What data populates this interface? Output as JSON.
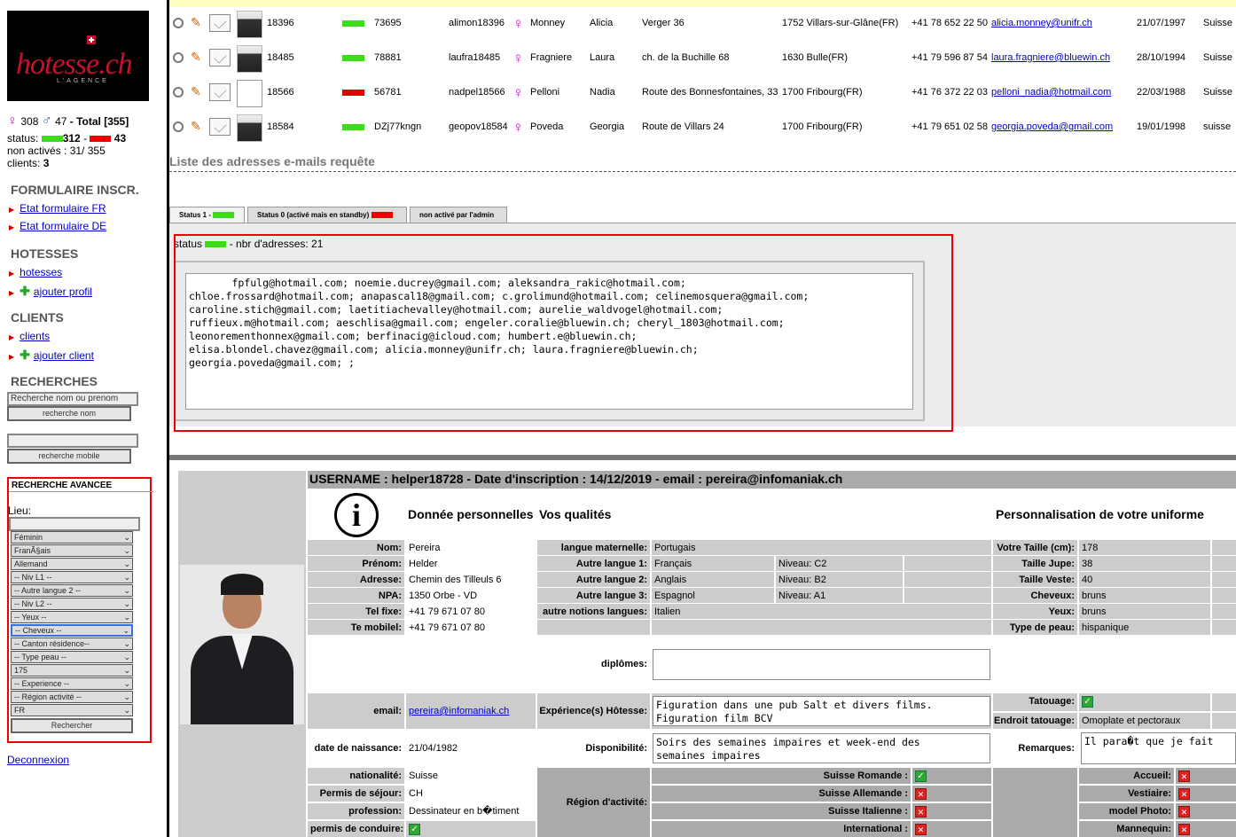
{
  "sidebar": {
    "logo_text": "hotesse.ch",
    "logo_sub": "L'AGENCE",
    "fem_count": "308",
    "male_count": "47",
    "total_label": "- Total [355]",
    "status_label": "status:",
    "status_green": "312",
    "status_sep": "-",
    "status_red": "43",
    "non_actives": "non activés : 31/ 355",
    "clients_label": "clients:",
    "clients_count": "3",
    "sect_form": "FORMULAIRE INSCR.",
    "form_fr": "Etat formulaire FR",
    "form_de": "Etat formulaire DE",
    "sect_hot": "HOTESSES",
    "hotesses": "hotesses",
    "ajouter_profil": "ajouter profil",
    "sect_cli": "CLIENTS",
    "clients": "clients",
    "ajouter_client": "ajouter client",
    "sect_rech": "RECHERCHES",
    "search_name_placeholder": "Recherche nom ou prenom",
    "search_name_btn": "recherche nom",
    "search_mobile_btn": "recherche mobile",
    "adv_title": "RECHERCHE AVANCEE",
    "lieu_label": "Lieu:",
    "selects": [
      "Féminin",
      "FranÃ§ais",
      "Allemand",
      "-- Niv L1 --",
      "-- Autre langue 2 --",
      "-- Niv L2 --",
      "-- Yeux --",
      "-- Cheveux --",
      "-- Canton résidence--",
      "-- Type peau --",
      "175",
      "-- Experience --",
      "-- Région activité --",
      "FR"
    ],
    "rechercher": "Rechercher",
    "deconnexion": "Deconnexion"
  },
  "rows": [
    {
      "id": "18396",
      "code": "73695",
      "user": "alimon18396",
      "nom": "Monney",
      "prenom": "Alicia",
      "adresse": "Verger 36",
      "ville": "1752 Villars-sur-Glâne(FR)",
      "tel": "+41 78 652 22 50",
      "email": "alicia.monney@unifr.ch",
      "date": "21/07/1997",
      "pays": "Suisse",
      "status": "green"
    },
    {
      "id": "18485",
      "code": "78881",
      "user": "laufra18485",
      "nom": "Fragniere",
      "prenom": "Laura",
      "adresse": "ch. de la Buchille 68",
      "ville": "1630 Bulle(FR)",
      "tel": "+41 79 596 87 54",
      "email": "laura.fragniere@bluewin.ch",
      "date": "28/10/1994",
      "pays": "Suisse",
      "status": "green"
    },
    {
      "id": "18566",
      "code": "56781",
      "user": "nadpel18566",
      "nom": "Pelloni",
      "prenom": "Nadia",
      "adresse": "Route des Bonnesfontaines, 33",
      "ville": "1700 Fribourg(FR)",
      "tel": "+41 76 372 22 03",
      "email": "pelloni_nadia@hotmail.com",
      "date": "22/03/1988",
      "pays": "Suisse",
      "status": "red"
    },
    {
      "id": "18584",
      "code": "DZj77kngn",
      "user": "geopov18584",
      "nom": "Poveda",
      "prenom": "Georgia",
      "adresse": "Route de Villars 24",
      "ville": "1700 Fribourg(FR)",
      "tel": "+41 79 651 02 58",
      "email": "georgia.poveda@gmail.com",
      "date": "19/01/1998",
      "pays": "suisse",
      "status": "green"
    }
  ],
  "liste_title": "Liste des adresses e-mails requête",
  "tabs": [
    "Status 1 -",
    "Status 0 (activé mais en standby)",
    "non activé par l'admin"
  ],
  "status_line_a": "status",
  "status_line_b": "- nbr d'adresses: 21",
  "emails_text": "       fpfulg@hotmail.com; noemie.ducrey@gmail.com; aleksandra_rakic@hotmail.com;\nchloe.frossard@hotmail.com; anapascal18@gmail.com; c.grolimund@hotmail.com; celinemosquera@gmail.com;\ncaroline.stich@gmail.com; laetitiachevalley@hotmail.com; aurelie_waldvogel@hotmail.com;\nruffieux.m@hotmail.com; aeschlisa@gmail.com; engeler.coralie@bluewin.ch; cheryl_1803@hotmail.com;\nleonorementhonnex@gmail.com; berfinacig@icloud.com; humbert.e@bluewin.ch;\nelisa.blondel.chavez@gmail.com; alicia.monney@unifr.ch; laura.fragniere@bluewin.ch;\ngeorgia.poveda@gmail.com; ;",
  "profile": {
    "header": "USERNAME : helper18728 - Date d'inscription : 14/12/2019 - email : pereira@infomaniak.ch",
    "h_perso": "Donnée personnelles",
    "h_qual": "Vos qualités",
    "h_unif": "Personnalisation de votre uniforme",
    "nom_l": "Nom:",
    "nom": "Pereira",
    "prenom_l": "Prénom:",
    "prenom": "Helder",
    "adresse_l": "Adresse:",
    "adresse": "Chemin des Tilleuls 6",
    "npa_l": "NPA:",
    "npa": "1350 Orbe - VD",
    "telf_l": "Tel fixe:",
    "telf": "+41 79 671 07 80",
    "telm_l": "Te mobilel:",
    "telm": "+41 79 671 07 80",
    "email_l": "email:",
    "email": "pereira@infomaniak.ch",
    "naiss_l": "date de naissance:",
    "naiss": "21/04/1982",
    "nat_l": "nationalité:",
    "nat": "Suisse",
    "permis_l": "Permis de séjour:",
    "permis": "CH",
    "prof_l": "profession:",
    "prof": "Dessinateur en b�timent",
    "perm_cond_l": "permis de conduire:",
    "lm_l": "langue maternelle:",
    "lm": "Portugais",
    "al1_l": "Autre langue 1:",
    "al1": "Français",
    "niv1": "Niveau: C2",
    "al2_l": "Autre langue 2:",
    "al2": "Anglais",
    "niv2": "Niveau: B2",
    "al3_l": "Autre langue 3:",
    "al3": "Espagnol",
    "niv3": "Niveau: A1",
    "notions_l": "autre notions langues:",
    "notions": "Italien",
    "dipl_l": "diplômes:",
    "exp_l": "Expérience(s) Hôtesse:",
    "exp": "Figuration dans une pub Salt et divers films.\nFiguration film BCV",
    "dispo_l": "Disponibilité:",
    "dispo": "Soirs des semaines impaires et week-end des\nsemaines impaires",
    "region_l": "Région d'activité:",
    "sr_l": "Suisse Romande :",
    "sa_l": "Suisse Allemande :",
    "si_l": "Suisse Italienne :",
    "int_l": "International :",
    "taille_l": "Votre Taille (cm):",
    "taille": "178",
    "jupe_l": "Taille Jupe:",
    "jupe": "38",
    "veste_l": "Taille Veste:",
    "veste": "40",
    "cheveux_l": "Cheveux:",
    "cheveux": "bruns",
    "yeux_l": "Yeux:",
    "yeux": "bruns",
    "peau_l": "Type de peau:",
    "peau": "hispanique",
    "tatou_l": "Tatouage:",
    "endroit_l": "Endroit tatouage:",
    "endroit": "Omoplate et pectoraux",
    "rem_l": "Remarques:",
    "rem": "Il para�t que je fait",
    "acc_l": "Accueil:",
    "vest_l": "Vestiaire:",
    "photo_l": "model Photo:",
    "mann_l": "Mannequin:"
  },
  "colors": {
    "accent_red": "#e00000",
    "accent_green": "#3ddc1a",
    "female": "#c020c0",
    "male": "#2070d0"
  }
}
